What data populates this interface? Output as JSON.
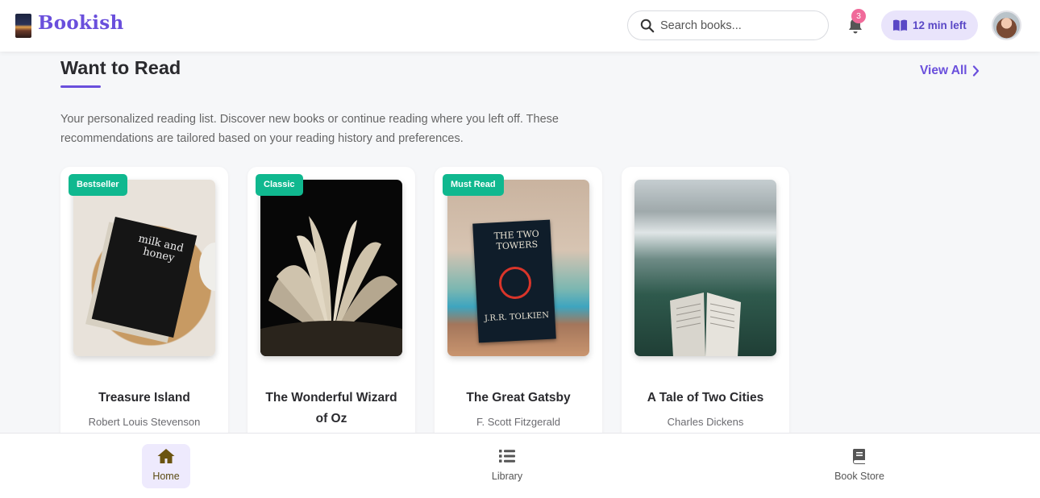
{
  "header": {
    "brand": "Bookish",
    "search_placeholder": "Search books...",
    "notifications_count": "3",
    "reading_timer": "12 min left"
  },
  "main": {
    "section_title": "Want to Read",
    "view_all": "View All",
    "intro": "Your personalized reading list. Discover new books or continue reading where you left off. These recommendations are tailored based on your reading history and preferences."
  },
  "books": [
    {
      "title": "Treasure Island",
      "author": "Robert Louis Stevenson",
      "tag": "Bestseller",
      "cover_text_1": "milk and",
      "cover_text_2": "honey"
    },
    {
      "title": "The Wonderful Wizard of Oz",
      "author": "",
      "tag": "Classic"
    },
    {
      "title": "The Great Gatsby",
      "author": "F. Scott Fitzgerald",
      "tag": "Must Read",
      "cover_text_1": "THE TWO TOWERS",
      "cover_text_2": "J.R.R. TOLKIEN"
    },
    {
      "title": "A Tale of Two Cities",
      "author": "Charles Dickens",
      "tag": ""
    }
  ],
  "bottom_nav": [
    {
      "label": "Home",
      "icon": "home-icon",
      "active": true
    },
    {
      "label": "Library",
      "icon": "list-icon",
      "active": false
    },
    {
      "label": "Book Store",
      "icon": "book-icon",
      "active": false
    }
  ],
  "colors": {
    "brand": "#6a4fdc",
    "tag": "#10b88f",
    "badge": "#f06a9a",
    "background": "#f6f7f9"
  }
}
